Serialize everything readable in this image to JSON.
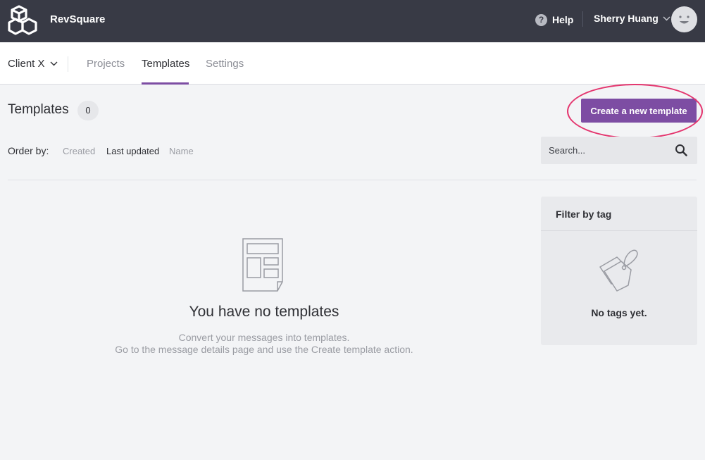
{
  "app": {
    "brand": "RevSquare"
  },
  "topbar": {
    "help_label": "Help",
    "user_name": "Sherry Huang"
  },
  "subnav": {
    "client": "Client X",
    "tabs": [
      {
        "label": "Projects",
        "active": false
      },
      {
        "label": "Templates",
        "active": true
      },
      {
        "label": "Settings",
        "active": false
      }
    ]
  },
  "header": {
    "title": "Templates",
    "count": "0",
    "create_label": "Create a new template"
  },
  "order": {
    "label": "Order by:",
    "options": [
      {
        "label": "Created",
        "active": false
      },
      {
        "label": "Last updated",
        "active": true
      },
      {
        "label": "Name",
        "active": false
      }
    ]
  },
  "search": {
    "placeholder": "Search..."
  },
  "empty": {
    "title": "You have no templates",
    "line1": "Convert your messages into templates.",
    "line2": "Go to the message details page and use the Create template action."
  },
  "filter": {
    "title": "Filter by tag",
    "empty": "No tags yet."
  },
  "colors": {
    "topbar": "#383a45",
    "accent": "#7d4da3",
    "highlight": "#e4356e",
    "background": "#f3f4f6"
  },
  "icons": [
    "logo-cubes-icon",
    "help-icon",
    "chevron-down-icon",
    "avatar-face-icon",
    "search-icon",
    "template-document-icon",
    "tag-icon"
  ]
}
